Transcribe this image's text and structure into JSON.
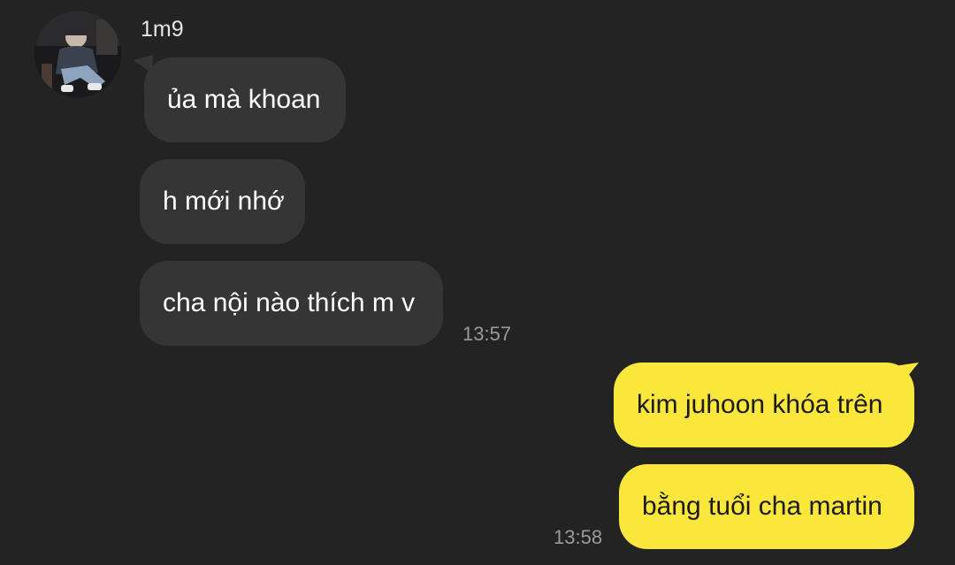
{
  "chat": {
    "sender": {
      "name": "1m9",
      "avatar_icon": "profile-photo-icon"
    },
    "incoming": [
      {
        "text": "ủa mà khoan"
      },
      {
        "text": "h mới nhớ"
      },
      {
        "text": "cha nội nào thích m v"
      }
    ],
    "incoming_time": "13:57",
    "outgoing": [
      {
        "text": "kim juhoon khóa trên"
      },
      {
        "text": "bằng tuổi cha martin"
      }
    ],
    "outgoing_time": "13:58"
  },
  "colors": {
    "background": "#232324",
    "incoming_bubble": "#353536",
    "outgoing_bubble": "#fbe63b"
  }
}
